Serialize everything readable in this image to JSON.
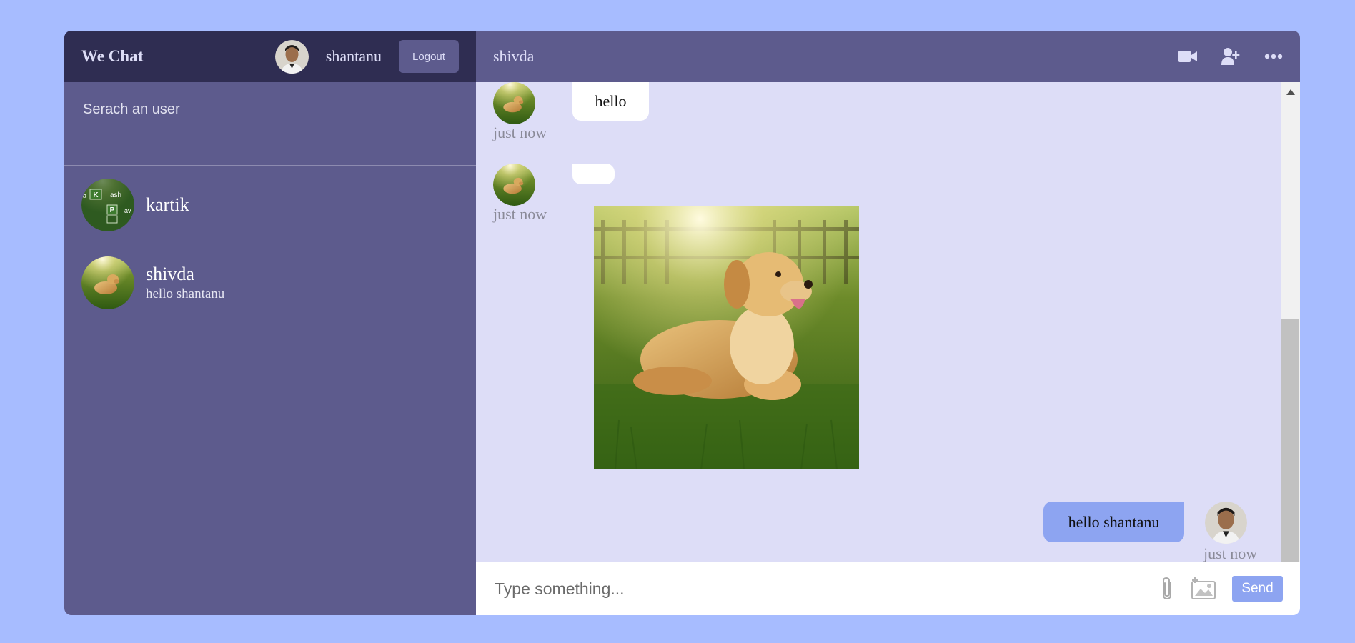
{
  "navbar": {
    "logo": "We Chat",
    "user_name": "shantanu",
    "logout_label": "Logout"
  },
  "search": {
    "placeholder": "Serach an user"
  },
  "chats": [
    {
      "name": "kartik",
      "last_message": ""
    },
    {
      "name": "shivda",
      "last_message": "hello shantanu"
    }
  ],
  "chat_header": {
    "title": "shivda",
    "icons": [
      "video-camera-icon",
      "add-user-icon",
      "more-icon"
    ]
  },
  "messages": [
    {
      "sender": "shivda",
      "owner": false,
      "text": "hello",
      "time": "just now"
    },
    {
      "sender": "shivda",
      "owner": false,
      "text": "",
      "time": "just now",
      "image": "golden retriever lying in grass"
    },
    {
      "sender": "shantanu",
      "owner": true,
      "text": "hello shantanu",
      "time": "just now"
    }
  ],
  "input": {
    "placeholder": "Type something...",
    "send_label": "Send",
    "icons": [
      "paperclip-icon",
      "add-image-icon"
    ]
  },
  "colors": {
    "page_bg": "#a7bcff",
    "navbar_bg": "#2f2d52",
    "sidebar_bg": "#5d5b8d",
    "chat_bg": "#ddddf7",
    "owner_bubble": "#8da4f1"
  }
}
